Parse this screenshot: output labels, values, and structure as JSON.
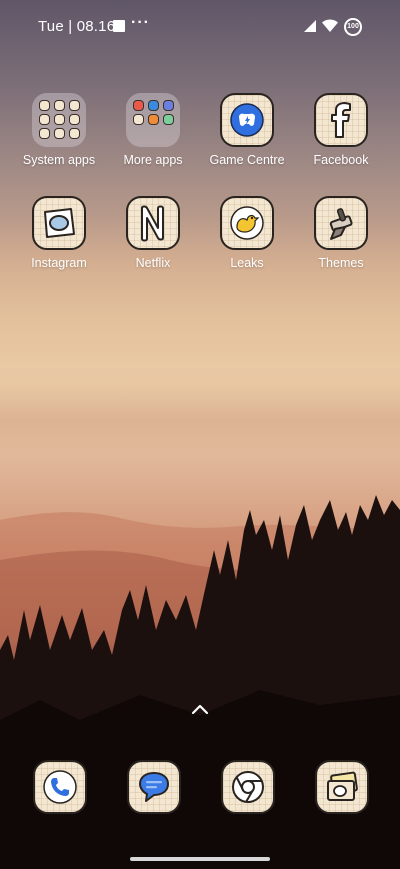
{
  "status_bar": {
    "time": "Tue | 08.16",
    "more": "···",
    "battery": "100",
    "icons": [
      "notification-square-icon",
      "signal-icon",
      "wifi-icon",
      "battery-icon"
    ]
  },
  "apps": [
    {
      "label": "System apps",
      "icon": "folder-icon"
    },
    {
      "label": "More apps",
      "icon": "folder-icon"
    },
    {
      "label": "Game Centre",
      "icon": "gamepad-icon"
    },
    {
      "label": "Facebook",
      "icon": "facebook-icon"
    },
    {
      "label": "Instagram",
      "icon": "instagram-icon"
    },
    {
      "label": "Netflix",
      "icon": "netflix-icon"
    },
    {
      "label": "Leaks",
      "icon": "bird-icon"
    },
    {
      "label": "Themes",
      "icon": "brush-icon"
    }
  ],
  "dock": [
    {
      "icon": "phone-icon"
    },
    {
      "icon": "messages-icon"
    },
    {
      "icon": "chrome-icon"
    },
    {
      "icon": "gallery-icon"
    }
  ],
  "colors": {
    "icon_bg": "#f3e7d2",
    "icon_outline": "#2a2420",
    "game_blue": "#2f6fe0",
    "leaks_yellow": "#f2c531"
  }
}
